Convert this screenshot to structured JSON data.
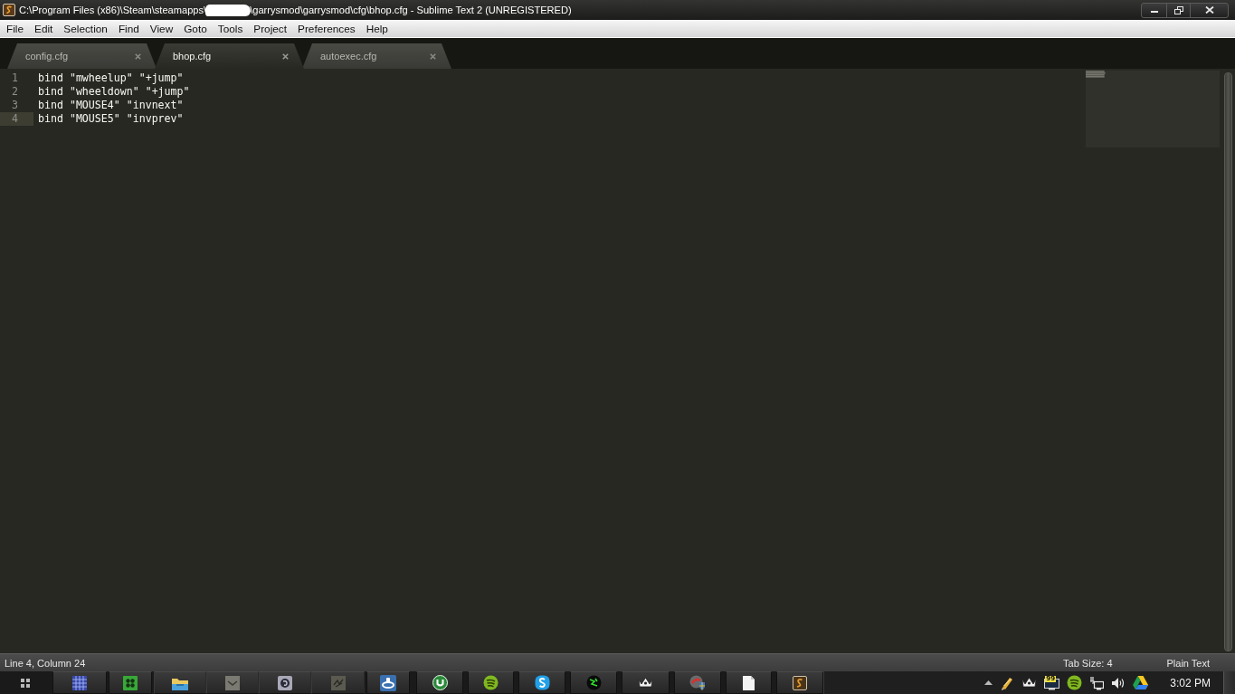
{
  "window": {
    "title_parts": [
      "C:\\Program Files (x86)\\Steam\\steamapps\\",
      "\\garrysmod\\garrysmod\\cfg\\bhop.cfg - Sublime Text 2 (UNREGISTERED)"
    ],
    "title_redacted": true
  },
  "menu_bar": [
    "File",
    "Edit",
    "Selection",
    "Find",
    "View",
    "Goto",
    "Tools",
    "Project",
    "Preferences",
    "Help"
  ],
  "tabs": [
    {
      "label": "config.cfg",
      "selected": false
    },
    {
      "label": "bhop.cfg",
      "selected": true
    },
    {
      "label": "autoexec.cfg",
      "selected": false
    }
  ],
  "editor": {
    "lines": [
      {
        "number": "1",
        "text": "bind \"mwheelup\" \"+jump\"",
        "current": false
      },
      {
        "number": "2",
        "text": "bind \"wheeldown\" \"+jump\"",
        "current": false
      },
      {
        "number": "3",
        "text": "bind \"MOUSE4\" \"invnext\"",
        "current": false
      },
      {
        "number": "4",
        "text": "bind \"MOUSE5\" \"invprev\"",
        "current": true
      }
    ]
  },
  "status_bar": {
    "position": "Line 4, Column 24",
    "tab_size": "Tab Size: 4",
    "syntax": "Plain Text"
  },
  "taskbar": {
    "tray_counter": "99",
    "clock": "3:02 PM"
  }
}
